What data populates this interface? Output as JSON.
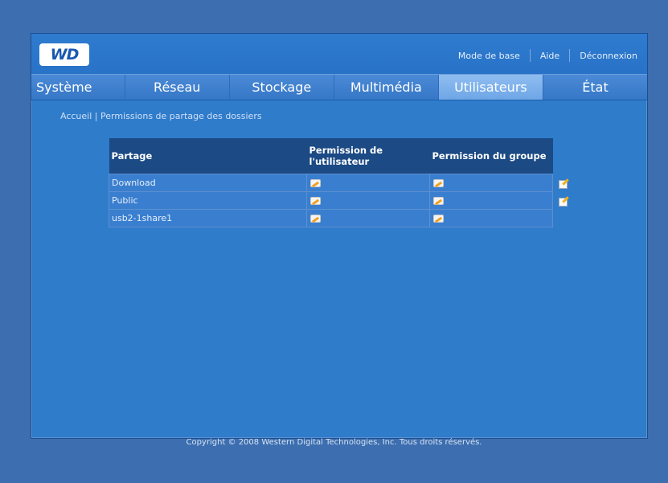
{
  "brand": {
    "logo_text": "WD"
  },
  "top_links": {
    "basic_mode": "Mode de base",
    "help": "Aide",
    "logout": "Déconnexion"
  },
  "nav": {
    "tabs": [
      {
        "label": "Système"
      },
      {
        "label": "Réseau"
      },
      {
        "label": "Stockage"
      },
      {
        "label": "Multimédia"
      },
      {
        "label": "Utilisateurs"
      },
      {
        "label": "État"
      }
    ],
    "active": "Utilisateurs"
  },
  "breadcrumb": {
    "home": "Accueil",
    "separator": "|",
    "current": "Permissions de partage des dossiers"
  },
  "table": {
    "headers": {
      "share": "Partage",
      "user_permission": "Permission de l'utilisateur",
      "group_permission": "Permission du groupe"
    },
    "rows": [
      {
        "name": "Download",
        "has_edit": true
      },
      {
        "name": "Public",
        "has_edit": true
      },
      {
        "name": "usb2-1share1",
        "has_edit": false
      }
    ]
  },
  "footer": {
    "copyright": "Copyright © 2008 Western Digital Technologies, Inc. Tous droits réservés."
  },
  "colors": {
    "background": "#3c6eb0",
    "panel": "#2f7ccb",
    "header_row": "#1b4a84",
    "active_tab": "#8fbdf0"
  }
}
